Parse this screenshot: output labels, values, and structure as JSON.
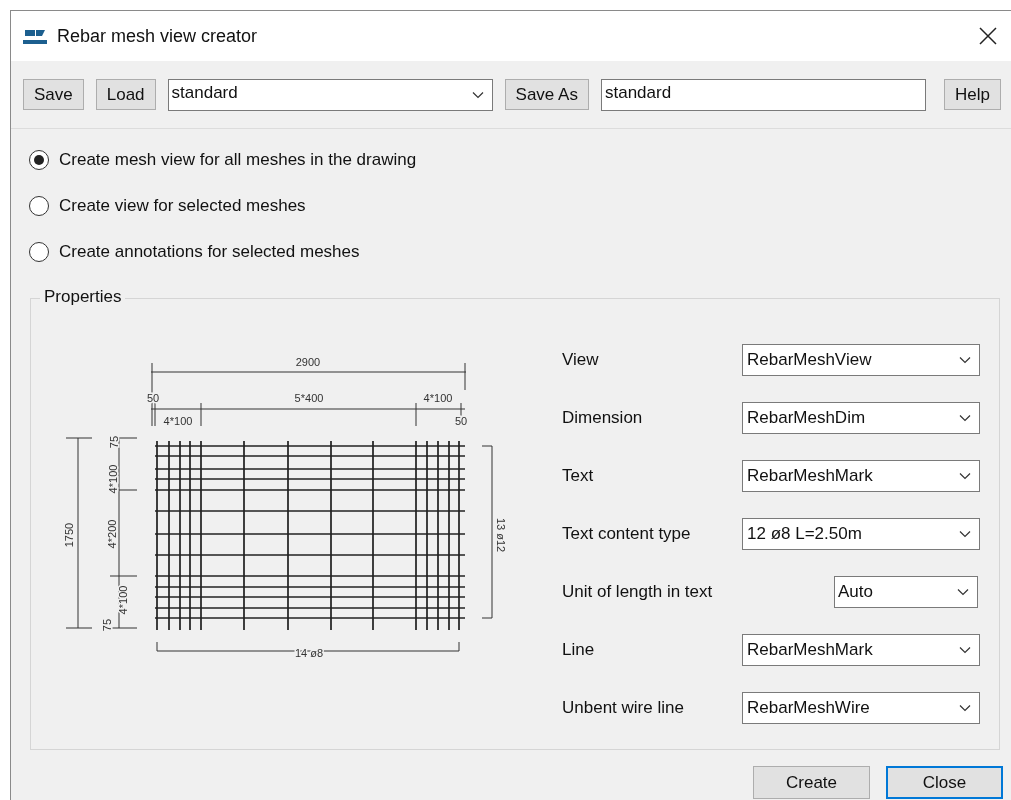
{
  "window": {
    "title": "Rebar mesh view creator"
  },
  "toolbar": {
    "save": "Save",
    "load": "Load",
    "preset": "standard",
    "save_as": "Save As",
    "save_as_name": "standard",
    "help": "Help"
  },
  "options": [
    {
      "label": "Create mesh view for all meshes in the drawing",
      "selected": true
    },
    {
      "label": "Create view for selected meshes",
      "selected": false
    },
    {
      "label": "Create annotations for selected meshes",
      "selected": false
    }
  ],
  "properties": {
    "title": "Properties",
    "drawing_labels": [
      "2900",
      "50",
      "5*400",
      "4*100",
      "4*100",
      "50",
      "1750",
      "75",
      "4*100",
      "4*200",
      "4*100",
      "75",
      "13 ø12",
      "14 ø8"
    ],
    "fields": [
      {
        "label": "View",
        "value": "RebarMeshView",
        "kind": "wide"
      },
      {
        "label": "Dimension",
        "value": "RebarMeshDim",
        "kind": "wide"
      },
      {
        "label": "Text",
        "value": "RebarMeshMark",
        "kind": "wide"
      },
      {
        "label": "Text content type",
        "value": "12 ø8 L=2.50m",
        "kind": "wide"
      },
      {
        "label": "Unit of length in text",
        "value": "Auto",
        "kind": "narrow"
      },
      {
        "label": "Line",
        "value": "RebarMeshMark",
        "kind": "wide"
      },
      {
        "label": "Unbent wire line",
        "value": "RebarMeshWire",
        "kind": "wide"
      }
    ]
  },
  "buttons": [
    {
      "label": "Create",
      "focused": false
    },
    {
      "label": "Close",
      "focused": true
    }
  ]
}
